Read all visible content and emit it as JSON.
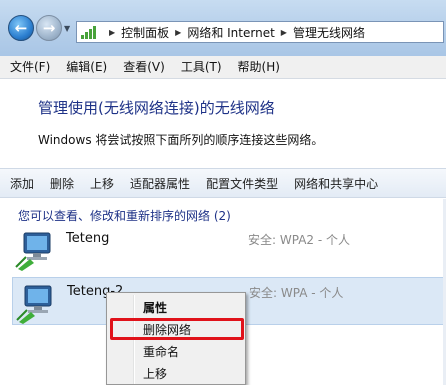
{
  "address_bar": {
    "back_icon": "back-arrow-icon",
    "forward_icon": "forward-arrow-icon",
    "breadcrumbs": [
      "控制面板",
      "网络和 Internet",
      "管理无线网络"
    ]
  },
  "menubar": {
    "items": [
      "文件(F)",
      "编辑(E)",
      "查看(V)",
      "工具(T)",
      "帮助(H)"
    ]
  },
  "header": {
    "title": "管理使用(无线网络连接)的无线网络",
    "subtitle": "Windows 将尝试按照下面所列的顺序连接这些网络。"
  },
  "toolbar": {
    "buttons": [
      "添加",
      "删除",
      "上移",
      "适配器属性",
      "配置文件类型",
      "网络和共享中心"
    ]
  },
  "list": {
    "group_header": "您可以查看、修改和重新排序的网络 (2)",
    "networks": [
      {
        "name": "Teteng",
        "security": "安全: WPA2 - 个人"
      },
      {
        "name": "Teteng-2",
        "security": "安全: WPA - 个人"
      }
    ]
  },
  "context_menu": {
    "items": [
      "属性",
      "删除网络",
      "重命名",
      "上移"
    ],
    "highlighted": "删除网络",
    "highlight_color": "#e0121a"
  },
  "colors": {
    "title_blue": "#1e3287",
    "selection_bg": "#dbe8f6"
  }
}
